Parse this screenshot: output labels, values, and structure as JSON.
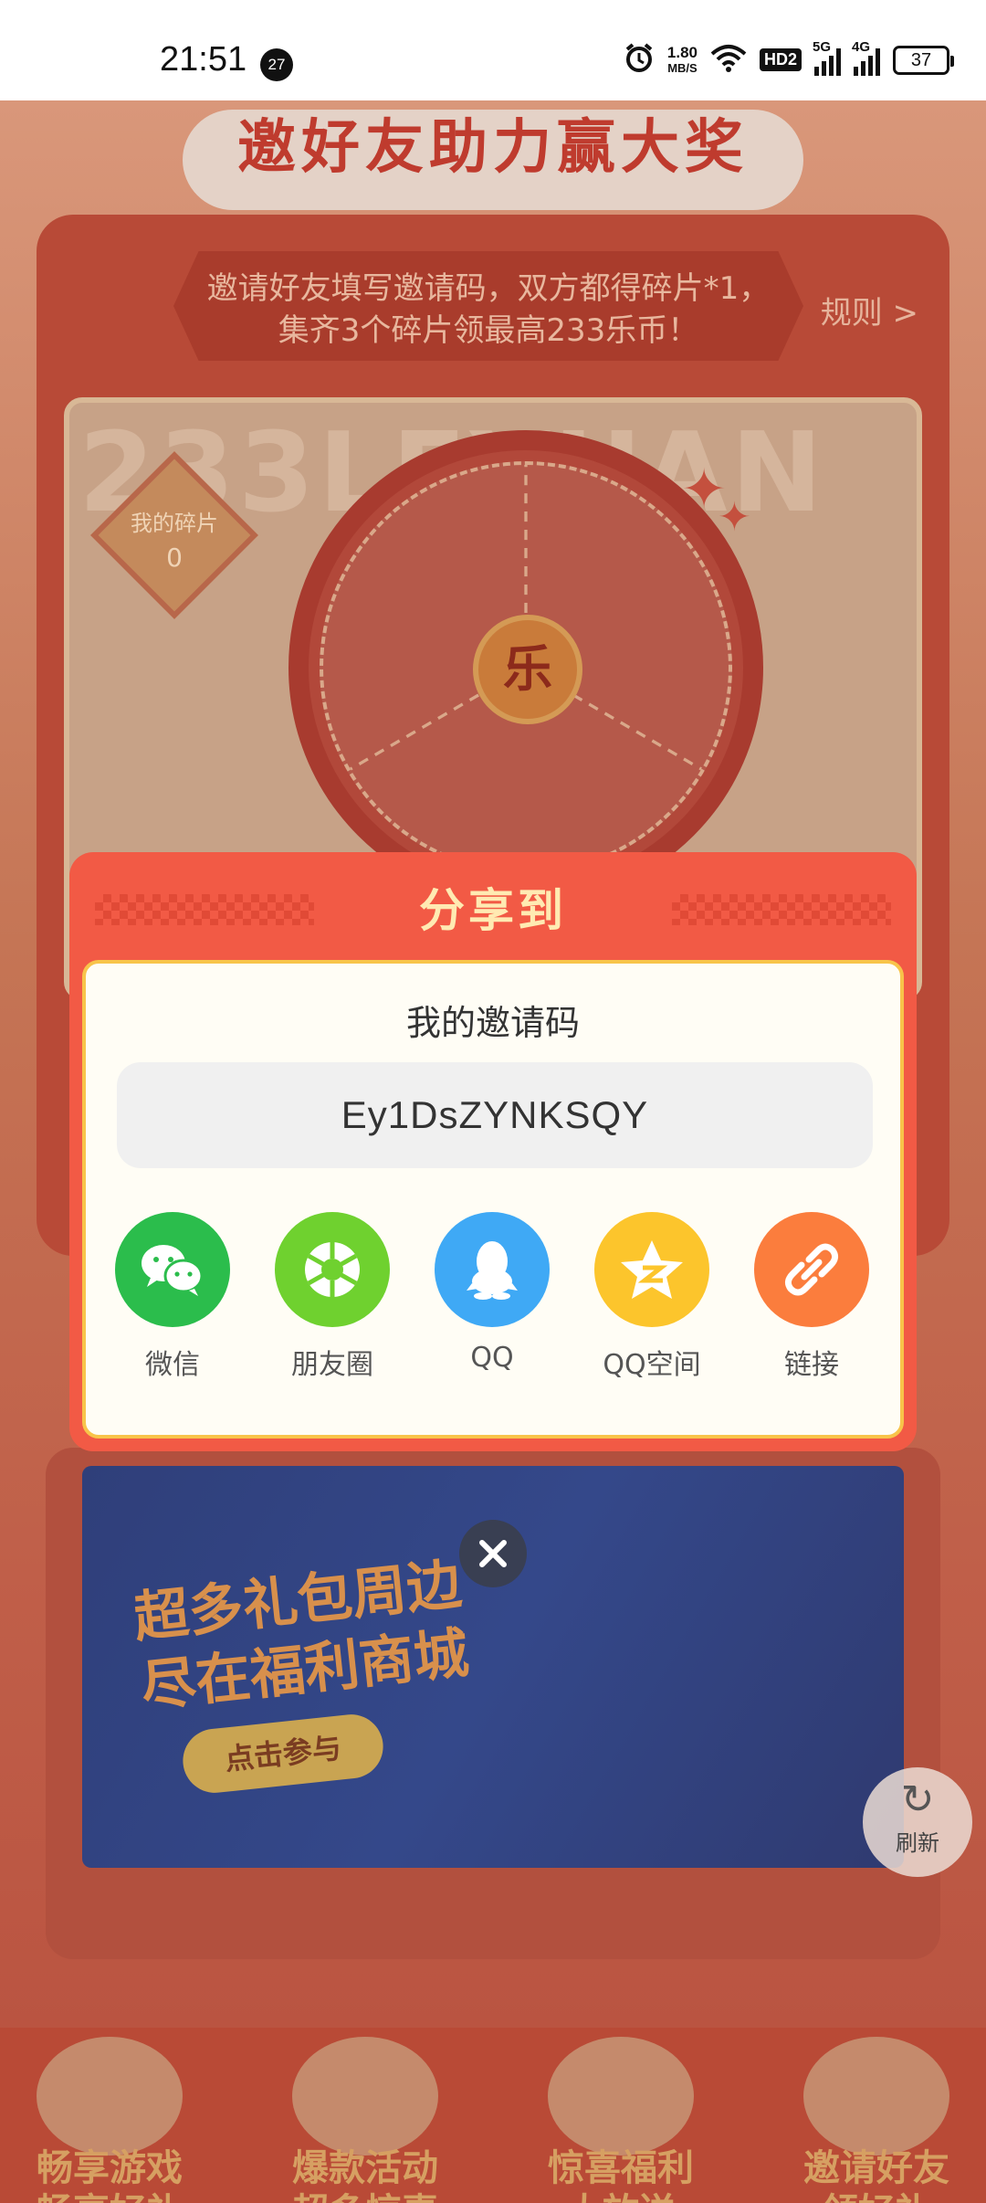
{
  "status_bar": {
    "time": "21:51",
    "notification_count": "27",
    "net_speed_value": "1.80",
    "net_speed_unit": "MB/S",
    "hd_label": "HD2",
    "signal1_label": "5G",
    "signal2_label": "4G",
    "battery": "37"
  },
  "background": {
    "banner_title": "邀好友助力赢大奖",
    "rule_text": "邀请好友填写邀请码，双方都得碎片*1，集齐3个碎片领最高233乐币！",
    "rules_link": "规则 >",
    "watermark": "233LEYUAN",
    "fragments_label": "我的碎片",
    "fragments_count": "0",
    "wheel_center": "乐",
    "promo_title_line1": "超多礼包周边",
    "promo_title_line2": "尽在福利商城",
    "promo_button": "点击参与",
    "refresh_label": "刷新"
  },
  "bottom_nav": [
    {
      "line1": "畅享游戏",
      "line2": "畅享好礼"
    },
    {
      "line1": "爆款活动",
      "line2": "超多惊喜"
    },
    {
      "line1": "惊喜福利",
      "line2": "大放送"
    },
    {
      "line1": "邀请好友",
      "line2": "领好礼"
    }
  ],
  "share_dialog": {
    "title": "分享到",
    "invite_label": "我的邀请码",
    "invite_code": "Ey1DsZYNKSQY",
    "options": [
      {
        "label": "微信",
        "icon": "wechat-icon",
        "color": "#2bbd4c"
      },
      {
        "label": "朋友圈",
        "icon": "moments-icon",
        "color": "#6fd12f"
      },
      {
        "label": "QQ",
        "icon": "qq-icon",
        "color": "#3fa9f5"
      },
      {
        "label": "QQ空间",
        "icon": "qzone-icon",
        "color": "#fcc52c"
      },
      {
        "label": "链接",
        "icon": "link-icon",
        "color": "#fb7d3d"
      }
    ]
  },
  "colors": {
    "dialog_red": "#f25a45",
    "dialog_title": "#ffeab2",
    "dialog_border": "#f8c44a"
  }
}
